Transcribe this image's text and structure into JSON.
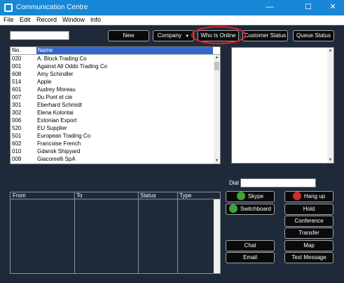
{
  "window": {
    "title": "Communication Centre",
    "controls": [
      "—",
      "☐",
      "✕"
    ]
  },
  "menu": {
    "items": [
      "File",
      "Edit",
      "Record",
      "Window",
      "Info"
    ]
  },
  "search": {
    "value": ""
  },
  "toolbar": {
    "new": "New",
    "company": "Company",
    "who_is_online": "Who Is Online",
    "customer_status": "Customer Status",
    "queue_status": "Queue Status"
  },
  "table": {
    "columns": {
      "no": "No.",
      "name": "Name"
    },
    "rows": [
      {
        "no": "020",
        "name": "A. Block Trading Co"
      },
      {
        "no": "001",
        "name": "Against All Odds Trading Co"
      },
      {
        "no": "608",
        "name": "Amy Schindler"
      },
      {
        "no": "514",
        "name": "Apple"
      },
      {
        "no": "601",
        "name": "Audrey Moreau"
      },
      {
        "no": "007",
        "name": "Du Pont et cie"
      },
      {
        "no": "301",
        "name": "Eberhard Schmidt"
      },
      {
        "no": "302",
        "name": "Elena Kolontai"
      },
      {
        "no": "006",
        "name": "Estonian Export"
      },
      {
        "no": "520",
        "name": "EU Supplier"
      },
      {
        "no": "501",
        "name": "European Trading Co"
      },
      {
        "no": "602",
        "name": "Francoise French"
      },
      {
        "no": "010",
        "name": "Gdansk Shipyard"
      },
      {
        "no": "009",
        "name": "Giacomelli SpA"
      }
    ]
  },
  "calls": {
    "columns": [
      "From",
      "To",
      "Status",
      "Type"
    ]
  },
  "dial": {
    "label": "Dial",
    "value": ""
  },
  "actions": {
    "skype": "Skype",
    "hang_up": "Hang up",
    "switchboard": "Switchboard",
    "hold": "Hold",
    "conference": "Conference",
    "transfer": "Transfer",
    "chat": "Chat",
    "map": "Map",
    "email": "Email",
    "text_message": "Text Message"
  },
  "colors": {
    "titlebar": "#1787d6",
    "background": "#1e2a3a",
    "selected_header": "#3366cc",
    "highlight_ring": "#e02020"
  }
}
